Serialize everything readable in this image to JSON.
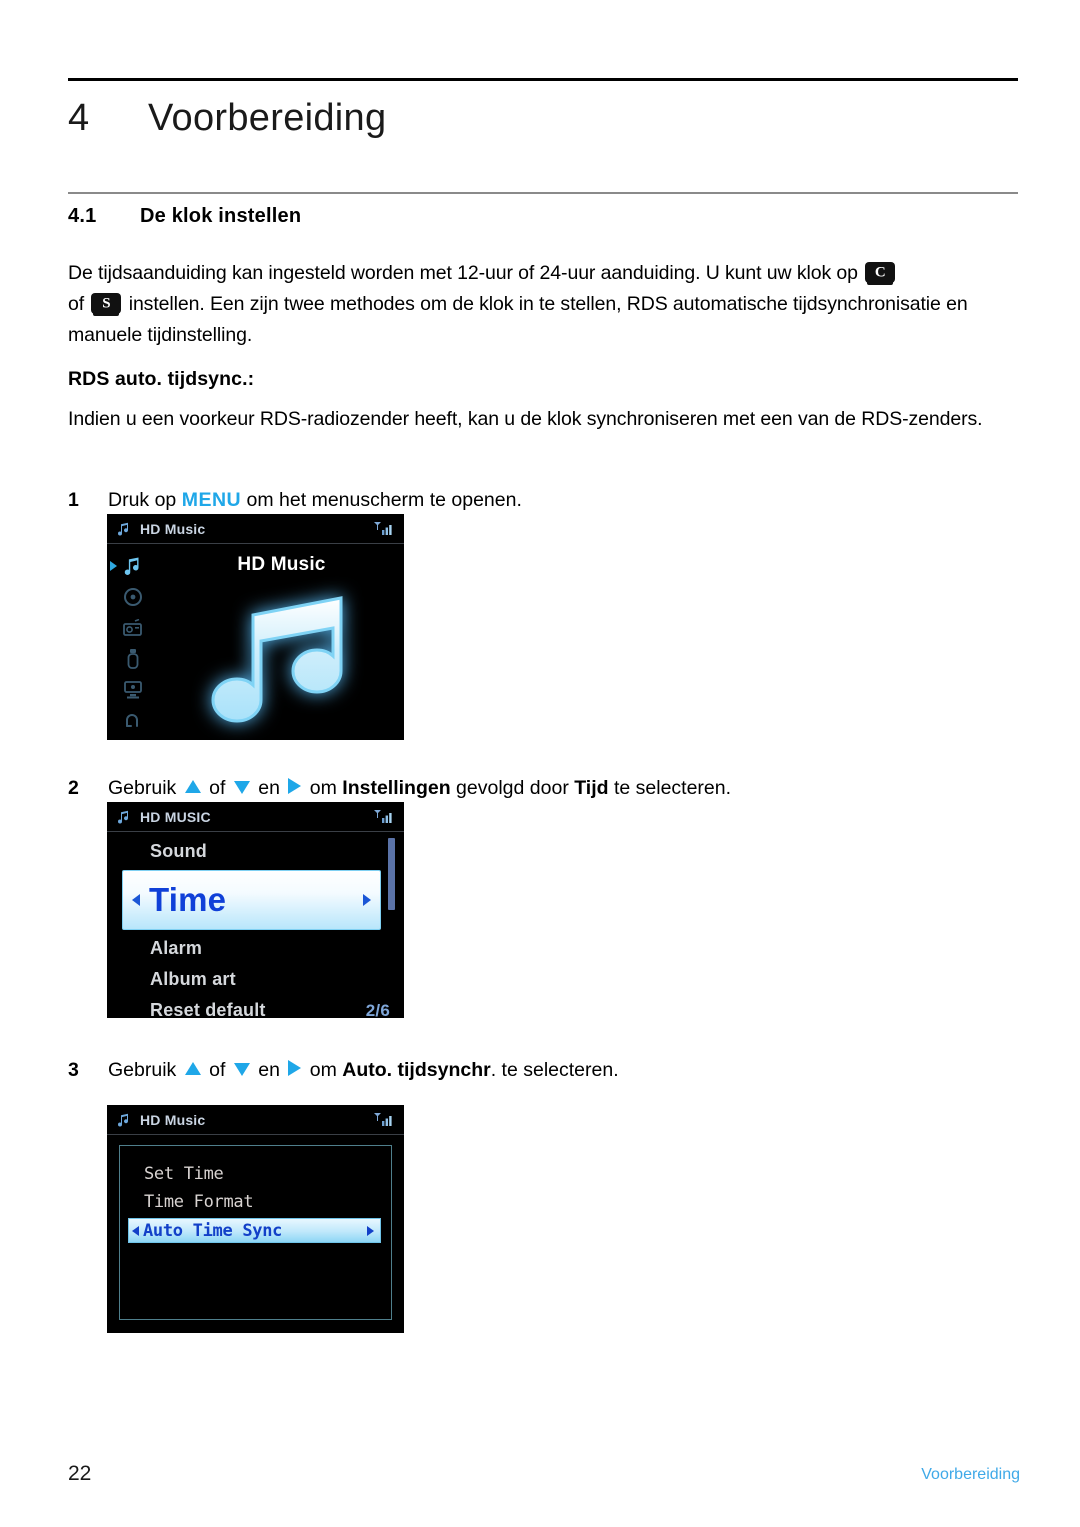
{
  "chapter": {
    "number": "4",
    "title": "Voorbereiding"
  },
  "section": {
    "number": "4.1",
    "title": "De klok instellen"
  },
  "intro": {
    "part1": "De tijdsaanduiding kan ingesteld worden met 12-uur of 24-uur aanduiding. U kunt uw klok op ",
    "icon1": "C",
    "part2": "of ",
    "icon2": "S",
    "part3": " instellen. Een zijn twee methodes om de klok in te stellen, RDS automatische tijdsynchronisatie en manuele tijdinstelling."
  },
  "rds": {
    "heading": "RDS auto. tijdsync.:",
    "paragraph": "Indien u een voorkeur RDS-radiozender heeft, kan u de klok synchroniseren met een van de RDS-zenders."
  },
  "steps": {
    "step1": {
      "number": "1",
      "before": "Druk op ",
      "key": "MENU",
      "after": " om het menuscherm te openen."
    },
    "step2": {
      "number": "2",
      "t1": "Gebruik ",
      "t2": " of ",
      "t3": " en ",
      "t4": " om ",
      "bold1": "Instellingen",
      "t5": " gevolgd door ",
      "bold2": "Tijd",
      "t6": " te selecteren."
    },
    "step3": {
      "number": "3",
      "t1": "Gebruik ",
      "t2": " of ",
      "t3": " en ",
      "t4": " om ",
      "bold1": "Auto. tijdsynchr",
      "t5": ". te selecteren."
    }
  },
  "lcd1": {
    "topbar_title": "HD Music",
    "music_icon": "music-note-icon",
    "signal_icon": "signal-strength-icon",
    "heading": "HD Music",
    "rail": [
      {
        "name": "hd-music",
        "icon": "music-note-icon",
        "selected": true
      },
      {
        "name": "cd",
        "icon": "disc-icon",
        "selected": false
      },
      {
        "name": "radio",
        "icon": "radio-icon",
        "selected": false
      },
      {
        "name": "usb",
        "icon": "usb-icon",
        "selected": false
      },
      {
        "name": "pc-link",
        "icon": "pc-link-icon",
        "selected": false
      },
      {
        "name": "back",
        "icon": "return-arrow-icon",
        "selected": false
      }
    ]
  },
  "lcd2": {
    "topbar_title": "HD MUSIC",
    "music_icon": "music-note-icon",
    "signal_icon": "signal-strength-icon",
    "rows": [
      {
        "label": "Sound",
        "selected": false,
        "count": ""
      },
      {
        "label": "Time",
        "selected": true,
        "count": ""
      },
      {
        "label": "Alarm",
        "selected": false,
        "count": ""
      },
      {
        "label": "Album art",
        "selected": false,
        "count": ""
      },
      {
        "label": "Reset default",
        "selected": false,
        "count": "2/6"
      }
    ]
  },
  "lcd3": {
    "topbar_title": "HD Music",
    "music_icon": "music-note-icon",
    "signal_icon": "signal-strength-icon",
    "rows": [
      {
        "label": "Set Time",
        "selected": false
      },
      {
        "label": "Time Format",
        "selected": false
      },
      {
        "label": "Auto Time Sync",
        "selected": true
      }
    ]
  },
  "footer": {
    "page_number": "22",
    "section_name": "Voorbereiding"
  },
  "colors": {
    "accent_blue": "#1fa7e8",
    "lcd_select_text": "#1040d8",
    "footer_link": "#3fa9e8"
  }
}
